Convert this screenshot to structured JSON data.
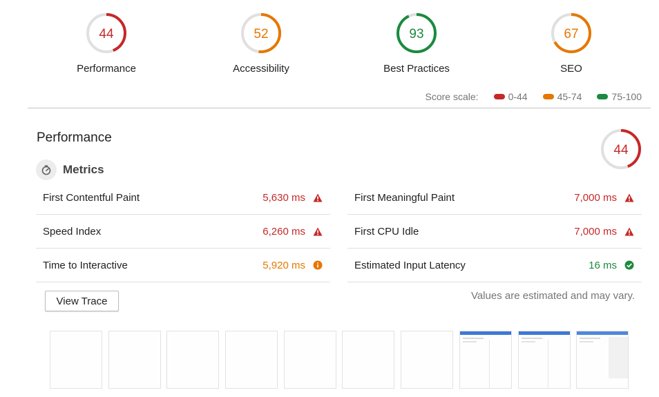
{
  "summary": {
    "gauges": [
      {
        "score": 44,
        "label": "Performance",
        "color": "#c62828"
      },
      {
        "score": 52,
        "label": "Accessibility",
        "color": "#e67700"
      },
      {
        "score": 93,
        "label": "Best Practices",
        "color": "#1b8a3e"
      },
      {
        "score": 67,
        "label": "SEO",
        "color": "#e67700"
      }
    ]
  },
  "score_scale": {
    "label": "Score scale:",
    "ranges": [
      {
        "label": "0-44",
        "color": "#c62828"
      },
      {
        "label": "45-74",
        "color": "#e67700"
      },
      {
        "label": "75-100",
        "color": "#1b8a3e"
      }
    ]
  },
  "performance": {
    "title": "Performance",
    "score": 44,
    "score_color": "#c62828",
    "metrics_title": "Metrics",
    "metrics_icon": "timer-icon",
    "metrics_left": [
      {
        "name": "First Contentful Paint",
        "value": "5,630 ms",
        "status": "fail",
        "icon": "warning-triangle-icon"
      },
      {
        "name": "Speed Index",
        "value": "6,260 ms",
        "status": "fail",
        "icon": "warning-triangle-icon"
      },
      {
        "name": "Time to Interactive",
        "value": "5,920 ms",
        "status": "average",
        "icon": "info-circle-icon"
      }
    ],
    "metrics_right": [
      {
        "name": "First Meaningful Paint",
        "value": "7,000 ms",
        "status": "fail",
        "icon": "warning-triangle-icon"
      },
      {
        "name": "First CPU Idle",
        "value": "7,000 ms",
        "status": "fail",
        "icon": "warning-triangle-icon"
      },
      {
        "name": "Estimated Input Latency",
        "value": "16 ms",
        "status": "pass",
        "icon": "check-circle-icon"
      }
    ],
    "view_trace_label": "View Trace",
    "estimate_note": "Values are estimated and may vary.",
    "filmstrip": [
      "blank",
      "blank",
      "blank",
      "blank",
      "blank",
      "blank",
      "blank",
      "page",
      "page",
      "page"
    ]
  }
}
